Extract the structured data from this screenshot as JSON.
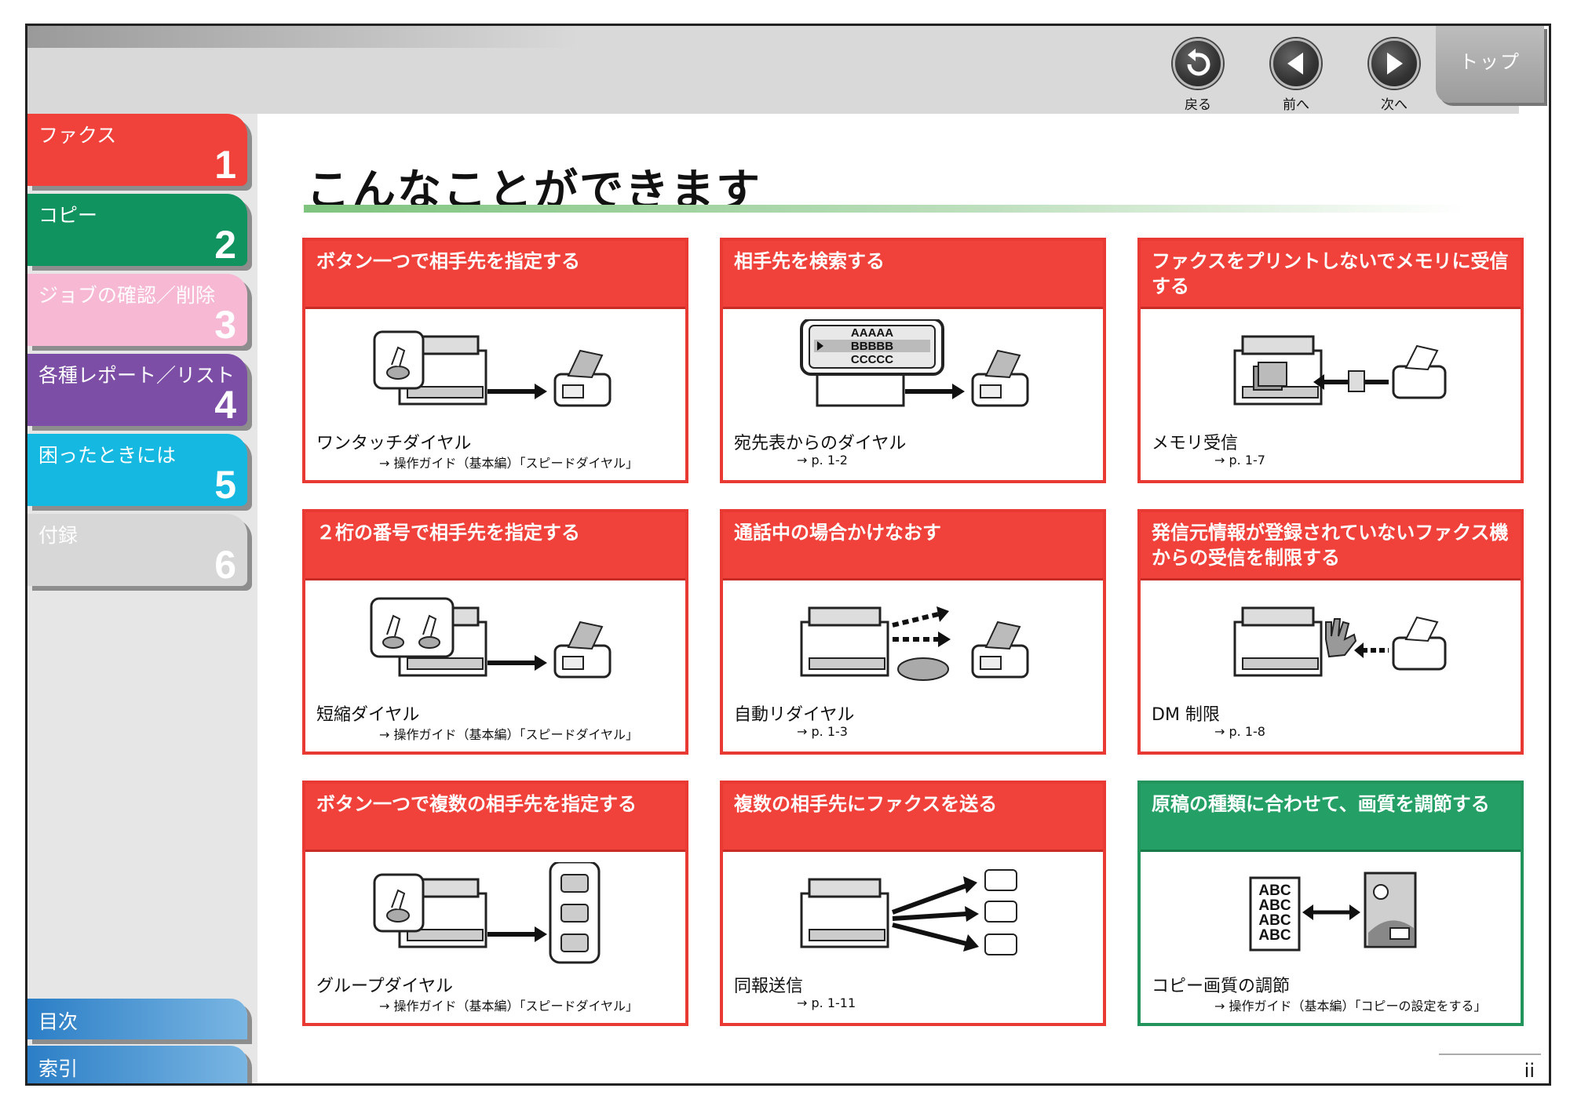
{
  "nav": {
    "back_label": "戻る",
    "prev_label": "前へ",
    "next_label": "次へ",
    "top_label": "トップ"
  },
  "sidebar": {
    "chapters": [
      {
        "title": "ファクス",
        "number": "1",
        "color": "#f0413a"
      },
      {
        "title": "コピー",
        "number": "2",
        "color": "#10935f"
      },
      {
        "title": "ジョブの確認／削除",
        "number": "3",
        "color": "#f7b8d4"
      },
      {
        "title": "各種レポート／リスト",
        "number": "4",
        "color": "#7d4ea6"
      },
      {
        "title": "困ったときには",
        "number": "5",
        "color": "#14b8e0"
      },
      {
        "title": "付録",
        "number": "6",
        "color": "#d7d7d7"
      }
    ],
    "toc_label": "目次",
    "index_label": "索引"
  },
  "page_title": "こんなことができます",
  "cards": [
    {
      "header": "ボタン一つで相手先を指定する",
      "name": "ワンタッチダイヤル",
      "ref": "→ 操作ガイド（基本編）「スピードダイヤル」",
      "illustration": "one-touch-dial-icon"
    },
    {
      "header": "相手先を検索する",
      "name": "宛先表からのダイヤル",
      "ref": "→ p. 1-2",
      "illustration": "address-book-dial-icon",
      "display_lines": [
        "AAAAA",
        "BBBBB",
        "CCCCC"
      ]
    },
    {
      "header": "ファクスをプリントしないでメモリに受信する",
      "name": "メモリ受信",
      "ref": "→ p. 1-7",
      "illustration": "memory-receive-icon"
    },
    {
      "header": "２桁の番号で相手先を指定する",
      "name": "短縮ダイヤル",
      "ref": "→ 操作ガイド（基本編）「スピードダイヤル」",
      "illustration": "coded-dial-icon"
    },
    {
      "header": "通話中の場合かけなおす",
      "name": "自動リダイヤル",
      "ref": "→ p. 1-3",
      "illustration": "auto-redial-icon"
    },
    {
      "header": "発信元情報が登録されていないファクス機からの受信を制限する",
      "name": "DM 制限",
      "ref": "→ p. 1-8",
      "illustration": "dm-restriction-icon"
    },
    {
      "header": "ボタン一つで複数の相手先を指定する",
      "name": "グループダイヤル",
      "ref": "→ 操作ガイド（基本編）「スピードダイヤル」",
      "illustration": "group-dial-icon"
    },
    {
      "header": "複数の相手先にファクスを送る",
      "name": "同報送信",
      "ref": "→ p. 1-11",
      "illustration": "broadcast-icon"
    },
    {
      "header": "原稿の種類に合わせて、画質を調節する",
      "name": "コピー画質の調節",
      "ref": "→ 操作ガイド（基本編）「コピーの設定をする」",
      "illustration": "image-quality-icon",
      "sample_text": "ABC"
    }
  ],
  "page_number": "ii"
}
